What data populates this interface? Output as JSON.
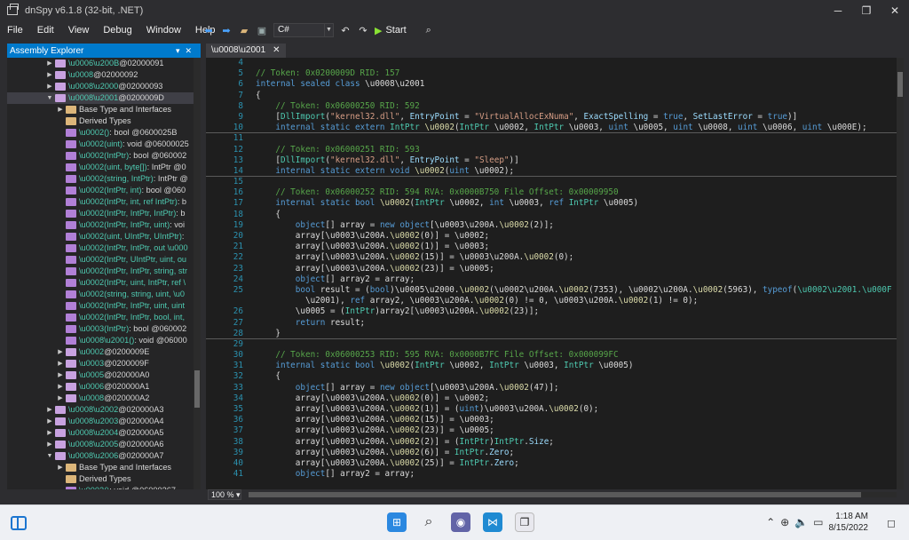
{
  "window": {
    "title": "dnSpy v6.1.8 (32-bit, .NET)"
  },
  "menu": [
    "File",
    "Edit",
    "View",
    "Debug",
    "Window",
    "Help"
  ],
  "toolbar": {
    "language": "C#",
    "start_label": "Start"
  },
  "explorer": {
    "title": "Assembly Explorer",
    "rows": [
      {
        "i": 3,
        "exp": "▶",
        "icon": "class",
        "name": "\\u0006\\u200B",
        "rest": " @02000091"
      },
      {
        "i": 3,
        "exp": "▶",
        "icon": "class",
        "name": "\\u0008",
        "rest": " @02000092"
      },
      {
        "i": 3,
        "exp": "▶",
        "icon": "class",
        "name": "\\u0008\\u2000",
        "rest": " @02000093"
      },
      {
        "i": 3,
        "exp": "▼",
        "icon": "class",
        "name": "\\u0008\\u2001",
        "rest": " @0200009D",
        "sel": true
      },
      {
        "i": 4,
        "exp": "▶",
        "icon": "folder",
        "name": "",
        "rest": "Base Type and Interfaces"
      },
      {
        "i": 4,
        "exp": "",
        "icon": "folder",
        "name": "",
        "rest": "Derived Types"
      },
      {
        "i": 4,
        "exp": "",
        "icon": "method",
        "name": "\\u0002()",
        "rest": " : bool @0600025B"
      },
      {
        "i": 4,
        "exp": "",
        "icon": "method",
        "name": "\\u0002(uint)",
        "rest": " : void @06000025"
      },
      {
        "i": 4,
        "exp": "",
        "icon": "method",
        "name": "\\u0002(IntPtr)",
        "rest": " : bool @060002"
      },
      {
        "i": 4,
        "exp": "",
        "icon": "method",
        "name": "\\u0002(uint, byte[])",
        "rest": " : IntPtr @0"
      },
      {
        "i": 4,
        "exp": "",
        "icon": "method",
        "name": "\\u0002(string, IntPtr)",
        "rest": " : IntPtr @"
      },
      {
        "i": 4,
        "exp": "",
        "icon": "method",
        "name": "\\u0002(IntPtr, int)",
        "rest": " : bool @060"
      },
      {
        "i": 4,
        "exp": "",
        "icon": "method",
        "name": "\\u0002(IntPtr, int, ref IntPtr)",
        "rest": " : b"
      },
      {
        "i": 4,
        "exp": "",
        "icon": "method",
        "name": "\\u0002(IntPtr, IntPtr, IntPtr)",
        "rest": " : b"
      },
      {
        "i": 4,
        "exp": "",
        "icon": "method",
        "name": "\\u0002(IntPtr, IntPtr, uint)",
        "rest": " : voi"
      },
      {
        "i": 4,
        "exp": "",
        "icon": "method",
        "name": "\\u0002(uint, UIntPtr, UIntPtr)",
        "rest": " :"
      },
      {
        "i": 4,
        "exp": "",
        "icon": "method",
        "name": "\\u0002(IntPtr, IntPtr, out \\u000",
        "rest": ""
      },
      {
        "i": 4,
        "exp": "",
        "icon": "method",
        "name": "\\u0002(IntPtr, UIntPtr, uint, ou",
        "rest": ""
      },
      {
        "i": 4,
        "exp": "",
        "icon": "method",
        "name": "\\u0002(IntPtr, IntPtr, string, str",
        "rest": ""
      },
      {
        "i": 4,
        "exp": "",
        "icon": "method",
        "name": "\\u0002(IntPtr, uint, IntPtr, ref \\",
        "rest": ""
      },
      {
        "i": 4,
        "exp": "",
        "icon": "method",
        "name": "\\u0002(string, string, uint, \\u0",
        "rest": ""
      },
      {
        "i": 4,
        "exp": "",
        "icon": "method",
        "name": "\\u0002(IntPtr, IntPtr, uint, uint",
        "rest": ""
      },
      {
        "i": 4,
        "exp": "",
        "icon": "method",
        "name": "\\u0002(IntPtr, IntPtr, bool, int,",
        "rest": ""
      },
      {
        "i": 4,
        "exp": "",
        "icon": "method",
        "name": "\\u0003(IntPtr)",
        "rest": " : bool @060002"
      },
      {
        "i": 4,
        "exp": "",
        "icon": "method",
        "name": "\\u0008\\u2001()",
        "rest": " : void @06000"
      },
      {
        "i": 4,
        "exp": "▶",
        "icon": "class",
        "name": "\\u0002",
        "rest": " @0200009E"
      },
      {
        "i": 4,
        "exp": "▶",
        "icon": "class",
        "name": "\\u0003",
        "rest": " @0200009F"
      },
      {
        "i": 4,
        "exp": "▶",
        "icon": "class",
        "name": "\\u0005",
        "rest": " @020000A0"
      },
      {
        "i": 4,
        "exp": "▶",
        "icon": "class",
        "name": "\\u0006",
        "rest": " @020000A1"
      },
      {
        "i": 4,
        "exp": "▶",
        "icon": "class",
        "name": "\\u0008",
        "rest": " @020000A2"
      },
      {
        "i": 3,
        "exp": "▶",
        "icon": "class",
        "name": "\\u0008\\u2002",
        "rest": " @020000A3"
      },
      {
        "i": 3,
        "exp": "▶",
        "icon": "class",
        "name": "\\u0008\\u2003",
        "rest": " @020000A4"
      },
      {
        "i": 3,
        "exp": "▶",
        "icon": "class",
        "name": "\\u0008\\u2004",
        "rest": " @020000A5"
      },
      {
        "i": 3,
        "exp": "▶",
        "icon": "class",
        "name": "\\u0008\\u2005",
        "rest": " @020000A6"
      },
      {
        "i": 3,
        "exp": "▼",
        "icon": "class",
        "name": "\\u0008\\u2006",
        "rest": " @020000A7"
      },
      {
        "i": 4,
        "exp": "▶",
        "icon": "folder",
        "name": "",
        "rest": "Base Type and Interfaces"
      },
      {
        "i": 4,
        "exp": "",
        "icon": "folder",
        "name": "",
        "rest": "Derived Types"
      },
      {
        "i": 4,
        "exp": "",
        "icon": "method",
        "name": "\\u0002()",
        "rest": " : void @06000267"
      }
    ]
  },
  "editor": {
    "tab_label": "\\u0008\\u2001",
    "zoom": "100 %",
    "lines": [
      {
        "n": "4",
        "h": ""
      },
      {
        "n": "5",
        "h": "<span class=\"c\">// Token: 0x0200009D RID: 157</span>"
      },
      {
        "n": "6",
        "h": "<span class=\"k\">internal sealed class</span> \\u0008\\u2001"
      },
      {
        "n": "7",
        "h": "{"
      },
      {
        "n": "8",
        "h": "    <span class=\"c\">// Token: 0x06000250 RID: 592</span>"
      },
      {
        "n": "9",
        "h": "    [<span class=\"t\">DllImport</span>(<span class=\"s\">\"kernel32.dll\"</span>, <span class=\"v\">EntryPoint</span> = <span class=\"s\">\"VirtualAllocExNuma\"</span>, <span class=\"v\">ExactSpelling</span> = <span class=\"k\">true</span>, <span class=\"v\">SetLastError</span> = <span class=\"k\">true</span>)]"
      },
      {
        "n": "10",
        "h": "    <span class=\"k\">internal static extern</span> <span class=\"t\">IntPtr</span> <span class=\"fn\">\\u0002</span>(<span class=\"t\">IntPtr</span> \\u0002, <span class=\"t\">IntPtr</span> \\u0003, <span class=\"k\">uint</span> \\u0005, <span class=\"k\">uint</span> \\u0008, <span class=\"k\">uint</span> \\u0006, <span class=\"k\">uint</span> \\u000E);",
        "sep": true
      },
      {
        "n": "11",
        "h": ""
      },
      {
        "n": "12",
        "h": "    <span class=\"c\">// Token: 0x06000251 RID: 593</span>"
      },
      {
        "n": "13",
        "h": "    [<span class=\"t\">DllImport</span>(<span class=\"s\">\"kernel32.dll\"</span>, <span class=\"v\">EntryPoint</span> = <span class=\"s\">\"Sleep\"</span>)]"
      },
      {
        "n": "14",
        "h": "    <span class=\"k\">internal static extern void</span> <span class=\"fn\">\\u0002</span>(<span class=\"k\">uint</span> \\u0002);",
        "sep": true
      },
      {
        "n": "15",
        "h": ""
      },
      {
        "n": "16",
        "h": "    <span class=\"c\">// Token: 0x06000252 RID: 594 RVA: 0x0000B750 File Offset: 0x00009950</span>"
      },
      {
        "n": "17",
        "h": "    <span class=\"k\">internal static bool</span> <span class=\"fn\">\\u0002</span>(<span class=\"t\">IntPtr</span> \\u0002, <span class=\"k\">int</span> \\u0003, <span class=\"k\">ref</span> <span class=\"t\">IntPtr</span> \\u0005)"
      },
      {
        "n": "18",
        "h": "    {"
      },
      {
        "n": "19",
        "h": "        <span class=\"k\">object</span>[] array = <span class=\"k\">new object</span>[\\u0003\\u200A.<span class=\"fn\">\\u0002</span>(2)];"
      },
      {
        "n": "20",
        "h": "        array[\\u0003\\u200A.<span class=\"fn\">\\u0002</span>(0)] = \\u0002;"
      },
      {
        "n": "21",
        "h": "        array[\\u0003\\u200A.<span class=\"fn\">\\u0002</span>(1)] = \\u0003;"
      },
      {
        "n": "22",
        "h": "        array[\\u0003\\u200A.<span class=\"fn\">\\u0002</span>(15)] = \\u0003\\u200A.<span class=\"fn\">\\u0002</span>(0);"
      },
      {
        "n": "23",
        "h": "        array[\\u0003\\u200A.<span class=\"fn\">\\u0002</span>(23)] = \\u0005;"
      },
      {
        "n": "24",
        "h": "        <span class=\"k\">object</span>[] array2 = array;"
      },
      {
        "n": "25",
        "h": "        <span class=\"k\">bool</span> result = (<span class=\"k\">bool</span>)\\u0005\\u2000.<span class=\"fn\">\\u0002</span>(\\u0002\\u200A.<span class=\"fn\">\\u0002</span>(7353), \\u0002\\u200A.<span class=\"fn\">\\u0002</span>(5963), <span class=\"k\">typeof</span>(<span class=\"t\">\\u0002\\u2001.\\u000F</span>"
      },
      {
        "n": "",
        "h": "          \\u2001), <span class=\"k\">ref</span> array2, \\u0003\\u200A.<span class=\"fn\">\\u0002</span>(0) != 0, \\u0003\\u200A.<span class=\"fn\">\\u0002</span>(1) != 0);"
      },
      {
        "n": "26",
        "h": "        \\u0005 = (<span class=\"t\">IntPtr</span>)array2[\\u0003\\u200A.<span class=\"fn\">\\u0002</span>(23)];"
      },
      {
        "n": "27",
        "h": "        <span class=\"k\">return</span> result;"
      },
      {
        "n": "28",
        "h": "    }",
        "sep": true
      },
      {
        "n": "29",
        "h": ""
      },
      {
        "n": "30",
        "h": "    <span class=\"c\">// Token: 0x06000253 RID: 595 RVA: 0x0000B7FC File Offset: 0x000099FC</span>"
      },
      {
        "n": "31",
        "h": "    <span class=\"k\">internal static bool</span> <span class=\"fn\">\\u0002</span>(<span class=\"t\">IntPtr</span> \\u0002, <span class=\"t\">IntPtr</span> \\u0003, <span class=\"t\">IntPtr</span> \\u0005)"
      },
      {
        "n": "32",
        "h": "    {"
      },
      {
        "n": "33",
        "h": "        <span class=\"k\">object</span>[] array = <span class=\"k\">new object</span>[\\u0003\\u200A.<span class=\"fn\">\\u0002</span>(47)];"
      },
      {
        "n": "34",
        "h": "        array[\\u0003\\u200A.<span class=\"fn\">\\u0002</span>(0)] = \\u0002;"
      },
      {
        "n": "35",
        "h": "        array[\\u0003\\u200A.<span class=\"fn\">\\u0002</span>(1)] = (<span class=\"k\">uint</span>)\\u0003\\u200A.<span class=\"fn\">\\u0002</span>(0);"
      },
      {
        "n": "36",
        "h": "        array[\\u0003\\u200A.<span class=\"fn\">\\u0002</span>(15)] = \\u0003;"
      },
      {
        "n": "37",
        "h": "        array[\\u0003\\u200A.<span class=\"fn\">\\u0002</span>(23)] = \\u0005;"
      },
      {
        "n": "38",
        "h": "        array[\\u0003\\u200A.<span class=\"fn\">\\u0002</span>(2)] = (<span class=\"t\">IntPtr</span>)<span class=\"t\">IntPtr</span>.<span class=\"v\">Size</span>;"
      },
      {
        "n": "39",
        "h": "        array[\\u0003\\u200A.<span class=\"fn\">\\u0002</span>(6)] = <span class=\"t\">IntPtr</span>.<span class=\"v\">Zero</span>;"
      },
      {
        "n": "40",
        "h": "        array[\\u0003\\u200A.<span class=\"fn\">\\u0002</span>(25)] = <span class=\"t\">IntPtr</span>.<span class=\"v\">Zero</span>;"
      },
      {
        "n": "41",
        "h": "        <span class=\"k\">object</span>[] array2 = array;"
      }
    ]
  },
  "taskbar": {
    "time": "1:18 AM",
    "date": "8/15/2022"
  },
  "colors": {
    "accent": "#007acc",
    "comment": "#57a64a",
    "keyword": "#569cd6",
    "string": "#d69d85",
    "type": "#4ec9b0"
  }
}
